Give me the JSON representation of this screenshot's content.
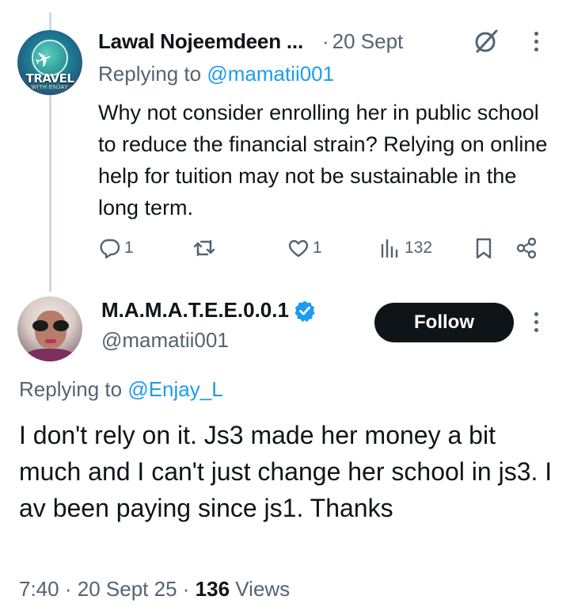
{
  "parent": {
    "author_name": "Lawal Nojeemdeen ...",
    "separator": "·",
    "timestamp": "20 Sept",
    "replying_prefix": "Replying to",
    "replying_handle": "@mamatii001",
    "text": "Why not consider enrolling her in public school to reduce the financial strain? Relying on online help for tuition may not be sustainable in the long term.",
    "avatar_text": "TRAVEL",
    "avatar_subtext": "WITH ENJAY",
    "icons": {
      "grok": "grok-icon",
      "more": "more-options-icon"
    },
    "actions": {
      "replies": "1",
      "reposts": "",
      "likes": "1",
      "views": "132"
    }
  },
  "main": {
    "author_name": "M.A.M.A.T.E.E.0.0.1",
    "handle": "@mamatii001",
    "follow_label": "Follow",
    "replying_prefix": "Replying to",
    "replying_handle": "@Enjay_L",
    "text": "I don't rely on it. Js3 made her money a bit much and I can't just change her school in js3. I av been paying since js1. Thanks",
    "time": "7:40",
    "date": "20 Sept 25",
    "separator": "·",
    "views_count": "136",
    "views_label": "Views"
  },
  "colors": {
    "accent": "#1d9bf0",
    "secondary_text": "#536471",
    "primary_text": "#0f1419",
    "thread_line": "#cfd9de",
    "follow_bg": "#0f1419"
  }
}
